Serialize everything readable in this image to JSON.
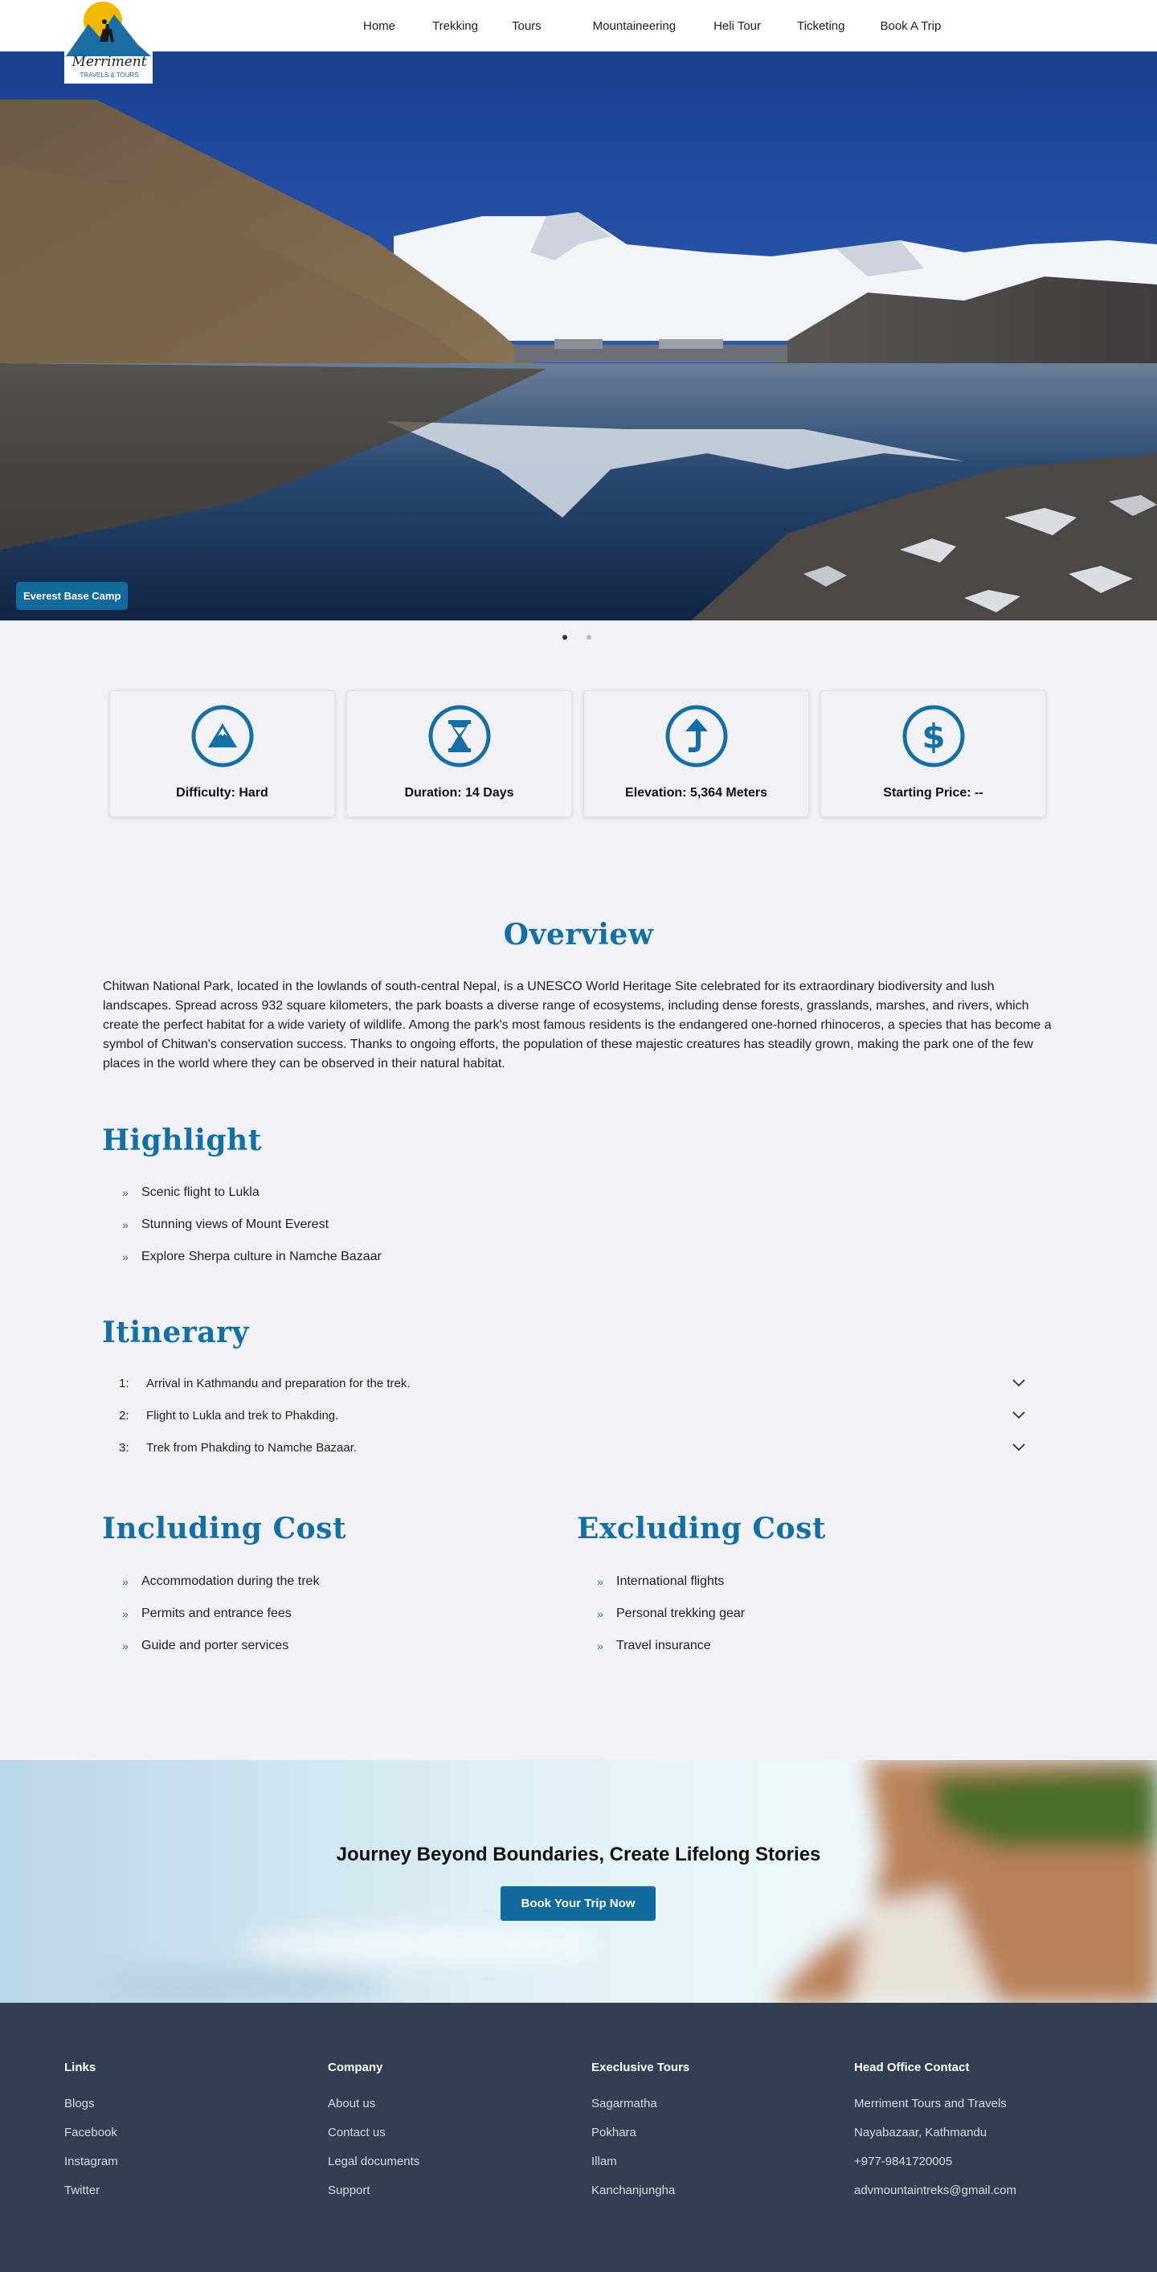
{
  "nav": {
    "logo_text": "Merriment",
    "logo_subtext": "TRAVELS & TOURS",
    "links": [
      "Home",
      "Trekking",
      "Tours",
      "Mountaineering",
      "Heli Tour",
      "Ticketing",
      "Book A Trip"
    ]
  },
  "hero": {
    "caption": "Everest Base Camp",
    "slides": 2,
    "active_slide": 1
  },
  "features": [
    {
      "icon": "mountain-icon",
      "label": "Difficulty: Hard"
    },
    {
      "icon": "hourglass-icon",
      "label": "Duration: 14 Days"
    },
    {
      "icon": "arrow-up-icon",
      "label": "Elevation: 5,364 Meters"
    },
    {
      "icon": "dollar-icon",
      "label": "Starting Price: --"
    }
  ],
  "overview": {
    "title": "Overview",
    "text": "Chitwan National Park, located in the lowlands of south-central Nepal, is a UNESCO World Heritage Site celebrated for its extraordinary biodiversity and lush landscapes. Spread across 932 square kilometers, the park boasts a diverse range of ecosystems, including dense forests, grasslands, marshes, and rivers, which create the perfect habitat for a wide variety of wildlife. Among the park's most famous residents is the endangered one-horned rhinoceros, a species that has become a symbol of Chitwan's conservation success. Thanks to ongoing efforts, the population of these majestic creatures has steadily grown, making the park one of the few places in the world where they can be observed in their natural habitat."
  },
  "highlight": {
    "title": "Highlight",
    "items": [
      "Scenic flight to Lukla",
      "Stunning views of Mount Everest",
      "Explore Sherpa culture in Namche Bazaar"
    ]
  },
  "itinerary": {
    "title": "Itinerary",
    "items": [
      {
        "num": "1:",
        "text": "Arrival in Kathmandu and preparation for the trek."
      },
      {
        "num": "2:",
        "text": "Flight to Lukla and trek to Phakding."
      },
      {
        "num": "3:",
        "text": "Trek from Phakding to Namche Bazaar."
      }
    ]
  },
  "including": {
    "title": "Including Cost",
    "items": [
      "Accommodation during the trek",
      "Permits and entrance fees",
      "Guide and porter services"
    ]
  },
  "excluding": {
    "title": "Excluding Cost",
    "items": [
      "International flights",
      "Personal trekking gear",
      "Travel insurance"
    ]
  },
  "cta": {
    "title": "Journey Beyond Boundaries, Create Lifelong Stories",
    "button": "Book Your Trip Now"
  },
  "footer": {
    "columns": [
      {
        "title": "Links",
        "items": [
          "Blogs",
          "Facebook",
          "Instagram",
          "Twitter"
        ]
      },
      {
        "title": "Company",
        "items": [
          "About us",
          "Contact us",
          "Legal documents",
          "Support"
        ]
      },
      {
        "title": "Execlusive Tours",
        "items": [
          "Sagarmatha",
          "Pokhara",
          "Illam",
          "Kanchanjungha"
        ]
      },
      {
        "title": "Head Office Contact",
        "items": [
          "Merriment Tours and Travels",
          "Nayabazaar, Kathmandu",
          "+977-9841720005",
          "advmountaintreks@gmail.com"
        ]
      }
    ]
  },
  "colors": {
    "brand_blue": "#146fa5",
    "button_blue": "#106a9e",
    "footer_bg": "#323e51",
    "page_bg": "#f2f2f6"
  }
}
